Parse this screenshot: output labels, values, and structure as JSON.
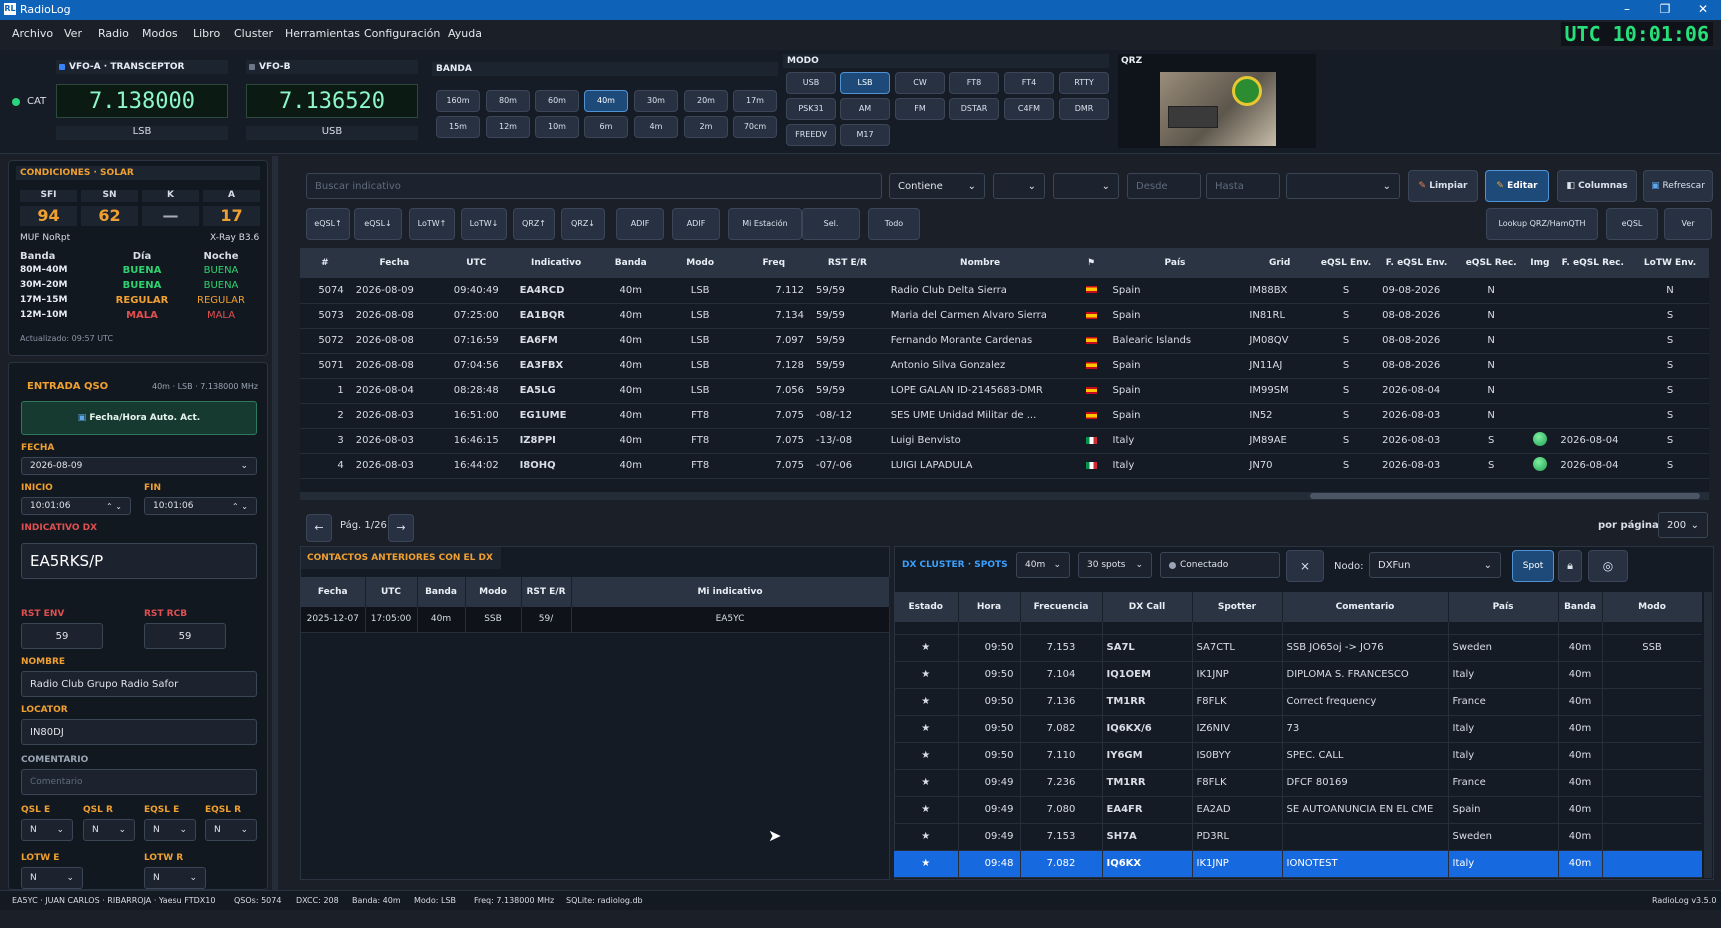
{
  "title": "RadioLog",
  "menu": [
    "Archivo",
    "Ver",
    "Radio",
    "Modos",
    "Libro",
    "Cluster",
    "Herramientas",
    "Configuración",
    "Ayuda"
  ],
  "utc": "UTC 10:01:06",
  "cat": "CAT",
  "vfoa": {
    "title": "VFO-A · TRANSCEPTOR",
    "freq": "7.138000",
    "mode": "LSB"
  },
  "vfob": {
    "title": "VFO-B",
    "freq": "7.136520",
    "mode": "USB"
  },
  "banda": {
    "title": "BANDA",
    "row1": [
      "160m",
      "80m",
      "60m",
      "40m",
      "30m",
      "20m",
      "17m"
    ],
    "row2": [
      "15m",
      "12m",
      "10m",
      "6m",
      "4m",
      "2m",
      "70cm"
    ],
    "selected": "40m"
  },
  "modo": {
    "title": "MODO",
    "row1": [
      "USB",
      "LSB",
      "CW",
      "FT8",
      "FT4",
      "RTTY"
    ],
    "row2": [
      "PSK31",
      "AM",
      "FM",
      "DSTAR",
      "C4FM",
      "DMR"
    ],
    "row3": [
      "FREEDV",
      "M17"
    ],
    "selected": "LSB"
  },
  "qrz": {
    "title": "QRZ"
  },
  "solar": {
    "title": "CONDICIONES · SOLAR",
    "heads": [
      "SFI",
      "SN",
      "K",
      "A"
    ],
    "vals": [
      "94",
      "62",
      "—",
      "17"
    ],
    "muf": "MUF NoRpt",
    "xray": "X-Ray B3.6",
    "cols": [
      "Banda",
      "Día",
      "Noche"
    ],
    "rows": [
      [
        "80M–40M",
        "BUENA",
        "BUENA"
      ],
      [
        "30M–20M",
        "BUENA",
        "BUENA"
      ],
      [
        "17M–15M",
        "REGULAR",
        "REGULAR"
      ],
      [
        "12M–10M",
        "MALA",
        "MALA"
      ]
    ],
    "updated": "Actualizado: 09:57 UTC"
  },
  "entry": {
    "title": "ENTRADA QSO",
    "info": "40m · LSB · 7.138000 MHz",
    "auto": "Fecha/Hora Auto. Act.",
    "fecha_l": "FECHA",
    "fecha": "2026-08-09",
    "inicio_l": "INICIO",
    "inicio": "10:01:06",
    "fin_l": "FIN",
    "fin": "10:01:06",
    "ind_l": "INDICATIVO DX",
    "ind": "EA5RKS/P",
    "rste_l": "RST ENV",
    "rste": "59",
    "rstr_l": "RST RCB",
    "rstr": "59",
    "nombre_l": "NOMBRE",
    "nombre": "Radio Club Grupo Radio Safor",
    "loc_l": "LOCATOR",
    "loc": "IN80DJ",
    "com_l": "COMENTARIO",
    "com_ph": "Comentario",
    "qsl": [
      "QSL E",
      "QSL R",
      "EQSL E",
      "EQSL R"
    ],
    "n": "N",
    "lotw": [
      "LOTW E",
      "LOTW R"
    ]
  },
  "search": {
    "ph": "Buscar indicativo",
    "mode": "Contiene",
    "desde": "Desde",
    "hasta": "Hasta",
    "limpiar": "Limpiar",
    "editar": "Editar",
    "columnas": "Columnas",
    "refrescar": "Refrescar"
  },
  "tools": [
    "eQSL↑",
    "eQSL↓",
    "LoTW↑",
    "LoTW↓",
    "QRZ↑",
    "QRZ↓",
    "ADIF",
    "ADIF",
    "Mi Estación",
    "Sel.",
    "Todo"
  ],
  "tools_r": [
    "Lookup QRZ/HamQTH",
    "eQSL",
    "Ver"
  ],
  "log": {
    "cols": [
      "#",
      "Fecha",
      "UTC",
      "Indicativo",
      "Banda",
      "Modo",
      "Freq",
      "RST E/R",
      "Nombre",
      "⚑",
      "País",
      "Grid",
      "eQSL Env.",
      "F. eQSL Env.",
      "eQSL Rec.",
      "Img",
      "F. eQSL Rec.",
      "LoTW Env."
    ],
    "rows": [
      [
        "5074",
        "2026-08-09",
        "09:40:49",
        "EA4RCD",
        "40m",
        "LSB",
        "7.112",
        "59/59",
        "Radio Club Delta Sierra",
        "es",
        "Spain",
        "IM88BX",
        "S",
        "09-08-2026",
        "N",
        "",
        "",
        "N"
      ],
      [
        "5073",
        "2026-08-08",
        "07:25:00",
        "EA1BQR",
        "40m",
        "LSB",
        "7.134",
        "59/59",
        "Maria del Carmen Alvaro Sierra",
        "es",
        "Spain",
        "IN81RL",
        "S",
        "08-08-2026",
        "N",
        "",
        "",
        "S"
      ],
      [
        "5072",
        "2026-08-08",
        "07:16:59",
        "EA6FM",
        "40m",
        "LSB",
        "7.097",
        "59/59",
        "Fernando Morante Cardenas",
        "es",
        "Balearic Islands",
        "JM08QV",
        "S",
        "08-08-2026",
        "N",
        "",
        "",
        "S"
      ],
      [
        "5071",
        "2026-08-08",
        "07:04:56",
        "EA3FBX",
        "40m",
        "LSB",
        "7.128",
        "59/59",
        "Antonio Silva Gonzalez",
        "es",
        "Spain",
        "JN11AJ",
        "S",
        "08-08-2026",
        "N",
        "",
        "",
        "S"
      ],
      [
        "1",
        "2026-08-04",
        "08:28:48",
        "EA5LG",
        "40m",
        "LSB",
        "7.056",
        "59/59",
        "LOPE GALAN ID-2145683-DMR",
        "es",
        "Spain",
        "IM99SM",
        "S",
        "2026-08-04",
        "N",
        "",
        "",
        "S"
      ],
      [
        "2",
        "2026-08-03",
        "16:51:00",
        "EG1UME",
        "40m",
        "FT8",
        "7.075",
        "-08/-12",
        "SES UME Unidad Militar de ...",
        "es",
        "Spain",
        "IN52",
        "S",
        "2026-08-03",
        "N",
        "",
        "",
        "S"
      ],
      [
        "3",
        "2026-08-03",
        "16:46:15",
        "IZ8PPI",
        "40m",
        "FT8",
        "7.075",
        "-13/-08",
        "Luigi Benvisto",
        "it",
        "Italy",
        "JM89AE",
        "S",
        "2026-08-03",
        "S",
        "img",
        "2026-08-04",
        "S"
      ],
      [
        "4",
        "2026-08-03",
        "16:44:02",
        "I8OHQ",
        "40m",
        "FT8",
        "7.075",
        "-07/-06",
        "LUIGI LAPADULA",
        "it",
        "Italy",
        "JN70",
        "S",
        "2026-08-03",
        "S",
        "img",
        "2026-08-04",
        "S"
      ]
    ]
  },
  "pager": {
    "text": "Pág. 1/26",
    "prev": "←",
    "next": "→",
    "per": "por página:",
    "pval": "200"
  },
  "prev": {
    "title": "CONTACTOS ANTERIORES CON EL DX",
    "cols": [
      "Fecha",
      "UTC",
      "Banda",
      "Modo",
      "RST E/R",
      "Mi indicativo"
    ],
    "rows": [
      [
        "2025-12-07",
        "17:05:00",
        "40m",
        "SSB",
        "59/",
        "EA5YC"
      ]
    ]
  },
  "cluster": {
    "title": "DX CLUSTER · SPOTS",
    "band": "40m",
    "spots": "30 spots",
    "status": "Conectado",
    "nodo_l": "Nodo:",
    "nodo": "DXFun",
    "spot": "Spot",
    "cols": [
      "Estado",
      "Hora",
      "Frecuencia",
      "DX Call",
      "Spotter",
      "Comentario",
      "País",
      "Banda",
      "Modo"
    ],
    "rows": [
      [
        "★",
        "09:50",
        "7.153",
        "SA7L",
        "SA7CTL",
        "SSB JO65oj -> JO76",
        "Sweden",
        "40m",
        "SSB"
      ],
      [
        "★",
        "09:50",
        "7.104",
        "IQ1OEM",
        "IK1JNP",
        "DIPLOMA S. FRANCESCO",
        "Italy",
        "40m",
        ""
      ],
      [
        "★",
        "09:50",
        "7.136",
        "TM1RR",
        "F8FLK",
        "Correct frequency",
        "France",
        "40m",
        ""
      ],
      [
        "★",
        "09:50",
        "7.082",
        "IQ6KX/6",
        "IZ6NIV",
        "73",
        "Italy",
        "40m",
        ""
      ],
      [
        "★",
        "09:50",
        "7.110",
        "IY6GM",
        "IS0BYY",
        "SPEC. CALL",
        "Italy",
        "40m",
        ""
      ],
      [
        "★",
        "09:49",
        "7.236",
        "TM1RR",
        "F8FLK",
        "DFCF 80169",
        "France",
        "40m",
        ""
      ],
      [
        "★",
        "09:49",
        "7.080",
        "EA4FR",
        "EA2AD",
        "SE AUTOANUNCIA EN EL CME",
        "Spain",
        "40m",
        ""
      ],
      [
        "★",
        "09:49",
        "7.153",
        "SH7A",
        "PD3RL",
        "",
        "Sweden",
        "40m",
        ""
      ],
      [
        "★",
        "09:48",
        "7.082",
        "IQ6KX",
        "IK1JNP",
        "IONOTEST",
        "Italy",
        "40m",
        ""
      ]
    ]
  },
  "status": {
    "op": "EA5YC · JUAN CARLOS · RIBARROJA · Yaesu FTDX10",
    "qsos": "QSOs: 5074",
    "dxcc": "DXCC: 208",
    "banda": "Banda: 40m",
    "modo": "Modo: LSB",
    "freq": "Freq: 7.138000 MHz",
    "db": "SQLite: radiolog.db",
    "ver": "RadioLog v3.5.0"
  },
  "colors": {
    "accent": "#1d6ef0",
    "green": "#27e07a",
    "orange": "#f0a030",
    "red": "#e05050"
  }
}
